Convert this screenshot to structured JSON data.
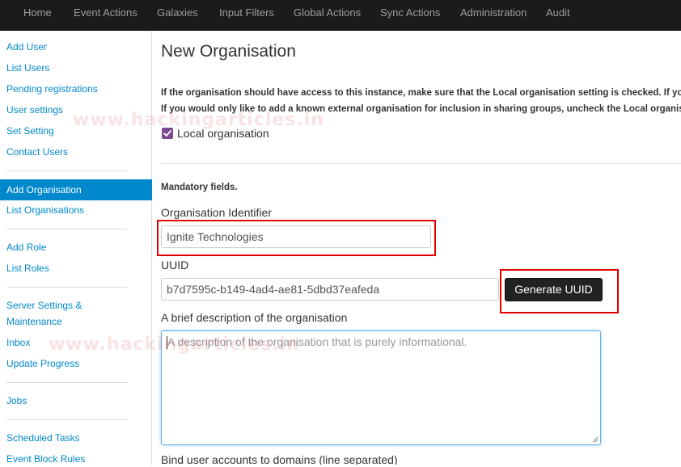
{
  "topnav": {
    "items": [
      "Home",
      "Event Actions",
      "Galaxies",
      "Input Filters",
      "Global Actions",
      "Sync Actions",
      "Administration",
      "Audit"
    ]
  },
  "sidebar": {
    "groups": [
      [
        "Add User",
        "List Users",
        "Pending registrations",
        "User settings",
        "Set Setting",
        "Contact Users"
      ],
      [
        "Add Organisation",
        "List Organisations"
      ],
      [
        "Add Role",
        "List Roles"
      ],
      [
        "Server Settings &",
        "Maintenance",
        "Inbox",
        "Update Progress"
      ],
      [
        "Jobs"
      ],
      [
        "Scheduled Tasks",
        "Event Block Rules"
      ]
    ],
    "active": "Add Organisation"
  },
  "form": {
    "title": "New Organisation",
    "info_line_1": "If the organisation should have access to this instance, make sure that the Local organisation setting is checked. If you would",
    "info_line_2": "If you would only like to add a known external organisation for inclusion in sharing groups, uncheck the Local organisation",
    "local_org_label": "Local organisation",
    "local_org_checked": true,
    "mandatory_label": "Mandatory fields.",
    "org_id_label": "Organisation Identifier",
    "org_id_value": "Ignite Technologies",
    "uuid_label": "UUID",
    "uuid_value": "b7d7595c-b149-4ad4-ae81-5dbd37eafeda",
    "generate_uuid_label": "Generate UUID",
    "description_label": "A brief description of the organisation",
    "description_placeholder": "A description of the organisation that is purely informational.",
    "bind_domains_label": "Bind user accounts to domains (line separated)"
  },
  "watermark": "www.hackingarticles.in",
  "colors": {
    "navbar": "#1b1b1b",
    "link": "#0088cc",
    "active": "#0088cc",
    "checkbox": "#7b4a93",
    "highlight": "#e00000"
  }
}
